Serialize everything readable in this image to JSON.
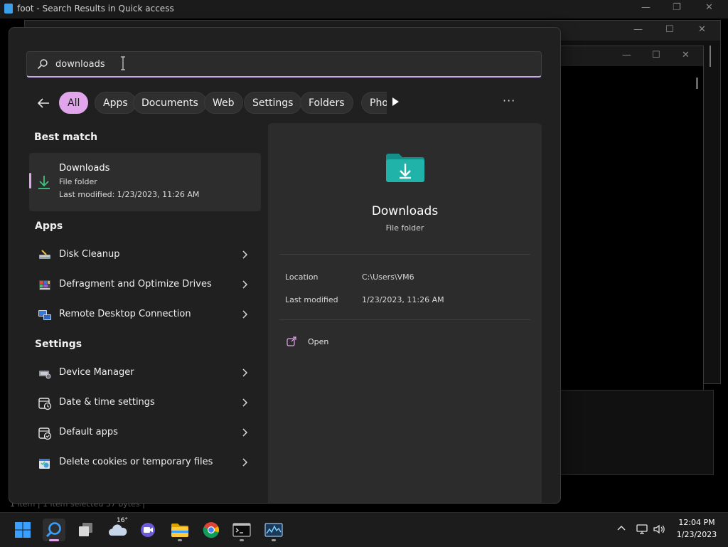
{
  "background": {
    "explorer_title": "foot - Search Results in Quick access",
    "status_text": "1 item  |  1 item selected  37 bytes  |"
  },
  "search": {
    "query": "downloads"
  },
  "filters": {
    "chips": [
      "All",
      "Apps",
      "Documents",
      "Web",
      "Settings",
      "Folders",
      "Pho"
    ],
    "active": "All",
    "more_label": "···"
  },
  "best_match": {
    "heading": "Best match",
    "name": "Downloads",
    "type": "File folder",
    "modified": "Last modified: 1/23/2023, 11:26 AM"
  },
  "apps": {
    "heading": "Apps",
    "items": [
      {
        "label": "Disk Cleanup",
        "icon": "disk-cleanup-icon"
      },
      {
        "label": "Defragment and Optimize Drives",
        "icon": "defrag-icon"
      },
      {
        "label": "Remote Desktop Connection",
        "icon": "remote-desktop-icon"
      }
    ]
  },
  "settings": {
    "heading": "Settings",
    "items": [
      {
        "label": "Device Manager",
        "icon": "device-manager-icon"
      },
      {
        "label": "Date & time settings",
        "icon": "date-time-icon"
      },
      {
        "label": "Default apps",
        "icon": "default-apps-icon"
      },
      {
        "label": "Delete cookies or temporary files",
        "icon": "internet-options-icon"
      }
    ]
  },
  "preview": {
    "name": "Downloads",
    "type": "File folder",
    "location_label": "Location",
    "location_value": "C:\\Users\\VM6",
    "modified_label": "Last modified",
    "modified_value": "1/23/2023, 11:26 AM",
    "open_label": "Open"
  },
  "taskbar": {
    "weather_temp": "16°",
    "time": "12:04 PM",
    "date": "1/23/2023",
    "apps": [
      "start-icon",
      "search-icon",
      "task-view-icon",
      "weather-icon",
      "meet-icon",
      "file-explorer-icon",
      "chrome-icon",
      "terminal-icon",
      "resource-monitor-icon"
    ]
  },
  "colors": {
    "accent": "#e0a5ea",
    "folder": "#1aa7a0",
    "flyout_bg": "#202020"
  }
}
